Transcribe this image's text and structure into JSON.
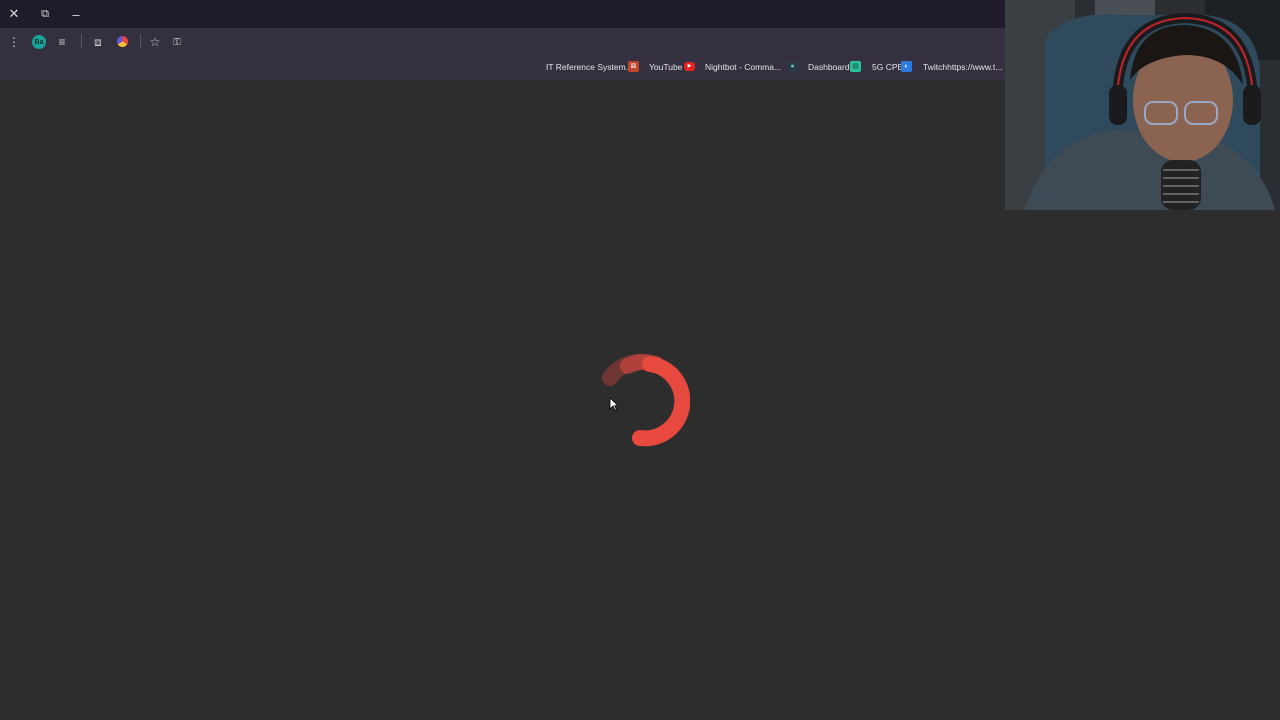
{
  "window": {
    "close_icon": "close-icon",
    "restore_icon": "restore-icon",
    "minimize_icon": "minimize-icon"
  },
  "toolbar": {
    "profile_initials": "Ba",
    "icons": [
      "menu-dots-icon",
      "reading-list-icon",
      "extensions-icon",
      "color-extension-icon",
      "star-icon",
      "password-key-icon"
    ]
  },
  "bookmarks": [
    {
      "label": "IT Reference System...",
      "icon": "it-reference-favicon"
    },
    {
      "label": "YouTube",
      "icon": "youtube-favicon"
    },
    {
      "label": "Nightbot - Comma...",
      "icon": "nightbot-favicon"
    },
    {
      "label": "Dashboard",
      "icon": "dashboard-favicon"
    },
    {
      "label": "5G CPE",
      "icon": "5g-cpe-favicon"
    },
    {
      "label": "Twitchhttps://www.t...",
      "icon": "twitch-favicon"
    }
  ],
  "content": {
    "state": "loading",
    "spinner_color": "#e8493f",
    "background": "#2d2d2d"
  },
  "colors": {
    "titlebar": "#1f1b2a",
    "toolbar": "#35303f"
  }
}
